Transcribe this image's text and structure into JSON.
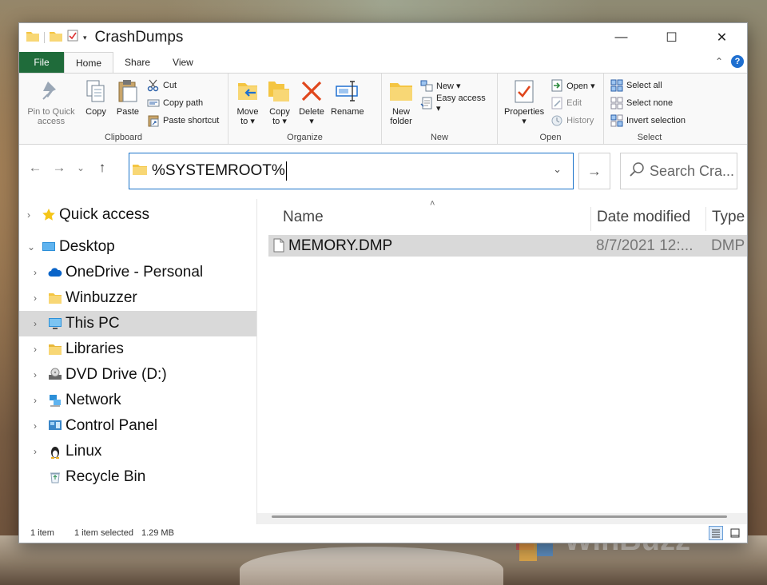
{
  "window": {
    "title": "CrashDumps",
    "controls": {
      "minimize": "—",
      "maximize": "☐",
      "close": "✕"
    }
  },
  "ribbon_tabs": {
    "file": "File",
    "home": "Home",
    "share": "Share",
    "view": "View",
    "help": "?"
  },
  "ribbon": {
    "clipboard": {
      "label": "Clipboard",
      "pin_to_quick_access": [
        "Pin to Quick",
        "access"
      ],
      "copy": "Copy",
      "paste": "Paste",
      "cut": "Cut",
      "copy_path": "Copy path",
      "paste_shortcut": "Paste shortcut"
    },
    "organize": {
      "label": "Organize",
      "move_to": [
        "Move",
        "to ▾"
      ],
      "copy_to": [
        "Copy",
        "to ▾"
      ],
      "delete": [
        "Delete",
        "▾"
      ],
      "rename": "Rename"
    },
    "new": {
      "label": "New",
      "new_folder": [
        "New",
        "folder"
      ],
      "new_item": "New ▾",
      "easy_access": "Easy access ▾"
    },
    "open": {
      "label": "Open",
      "properties": [
        "Properties",
        "▾"
      ],
      "open": "Open ▾",
      "edit": "Edit",
      "history": "History"
    },
    "select": {
      "label": "Select",
      "select_all": "Select all",
      "select_none": "Select none",
      "invert_selection": "Invert selection"
    }
  },
  "address_bar": {
    "value": "%SYSTEMROOT%",
    "dropdown": "⌄",
    "go": "→"
  },
  "search": {
    "placeholder": "Search Cra..."
  },
  "nav": {
    "back": "←",
    "forward": "→",
    "recent": "⌄",
    "up": "↑"
  },
  "navigation_pane": [
    {
      "label": "Quick access",
      "chevron": "›",
      "icon": "star-icon"
    },
    {
      "label": "Desktop",
      "chevron": "⌄",
      "icon": "desktop-icon"
    },
    {
      "label": "OneDrive - Personal",
      "chevron": "›",
      "icon": "onedrive-icon"
    },
    {
      "label": "Winbuzzer",
      "chevron": "›",
      "icon": "folder-icon"
    },
    {
      "label": "This PC",
      "chevron": "›",
      "icon": "pc-icon"
    },
    {
      "label": "Libraries",
      "chevron": "›",
      "icon": "libraries-icon"
    },
    {
      "label": "DVD Drive (D:)",
      "chevron": "›",
      "icon": "dvd-drive-icon"
    },
    {
      "label": "Network",
      "chevron": "›",
      "icon": "network-icon"
    },
    {
      "label": "Control Panel",
      "chevron": "›",
      "icon": "control-panel-icon"
    },
    {
      "label": "Linux",
      "chevron": "›",
      "icon": "linux-icon"
    },
    {
      "label": "Recycle Bin",
      "chevron": "",
      "icon": "recycle-bin-icon"
    }
  ],
  "file_list": {
    "sort_indicator": "˄",
    "columns": {
      "name": "Name",
      "date_modified": "Date modified",
      "type": "Type"
    },
    "rows": [
      {
        "name": "MEMORY.DMP",
        "date_modified": "8/7/2021 12:...",
        "type": "DMP"
      }
    ]
  },
  "status_bar": {
    "item_count": "1 item",
    "selected": "1 item selected",
    "size": "1.29 MB"
  },
  "watermark": {
    "text": "WinBuzz"
  },
  "colors": {
    "accent": "#1a73c9",
    "file_tab": "#1f6b3a",
    "selection": "#d9d9d9",
    "folder": "#f4c542"
  }
}
